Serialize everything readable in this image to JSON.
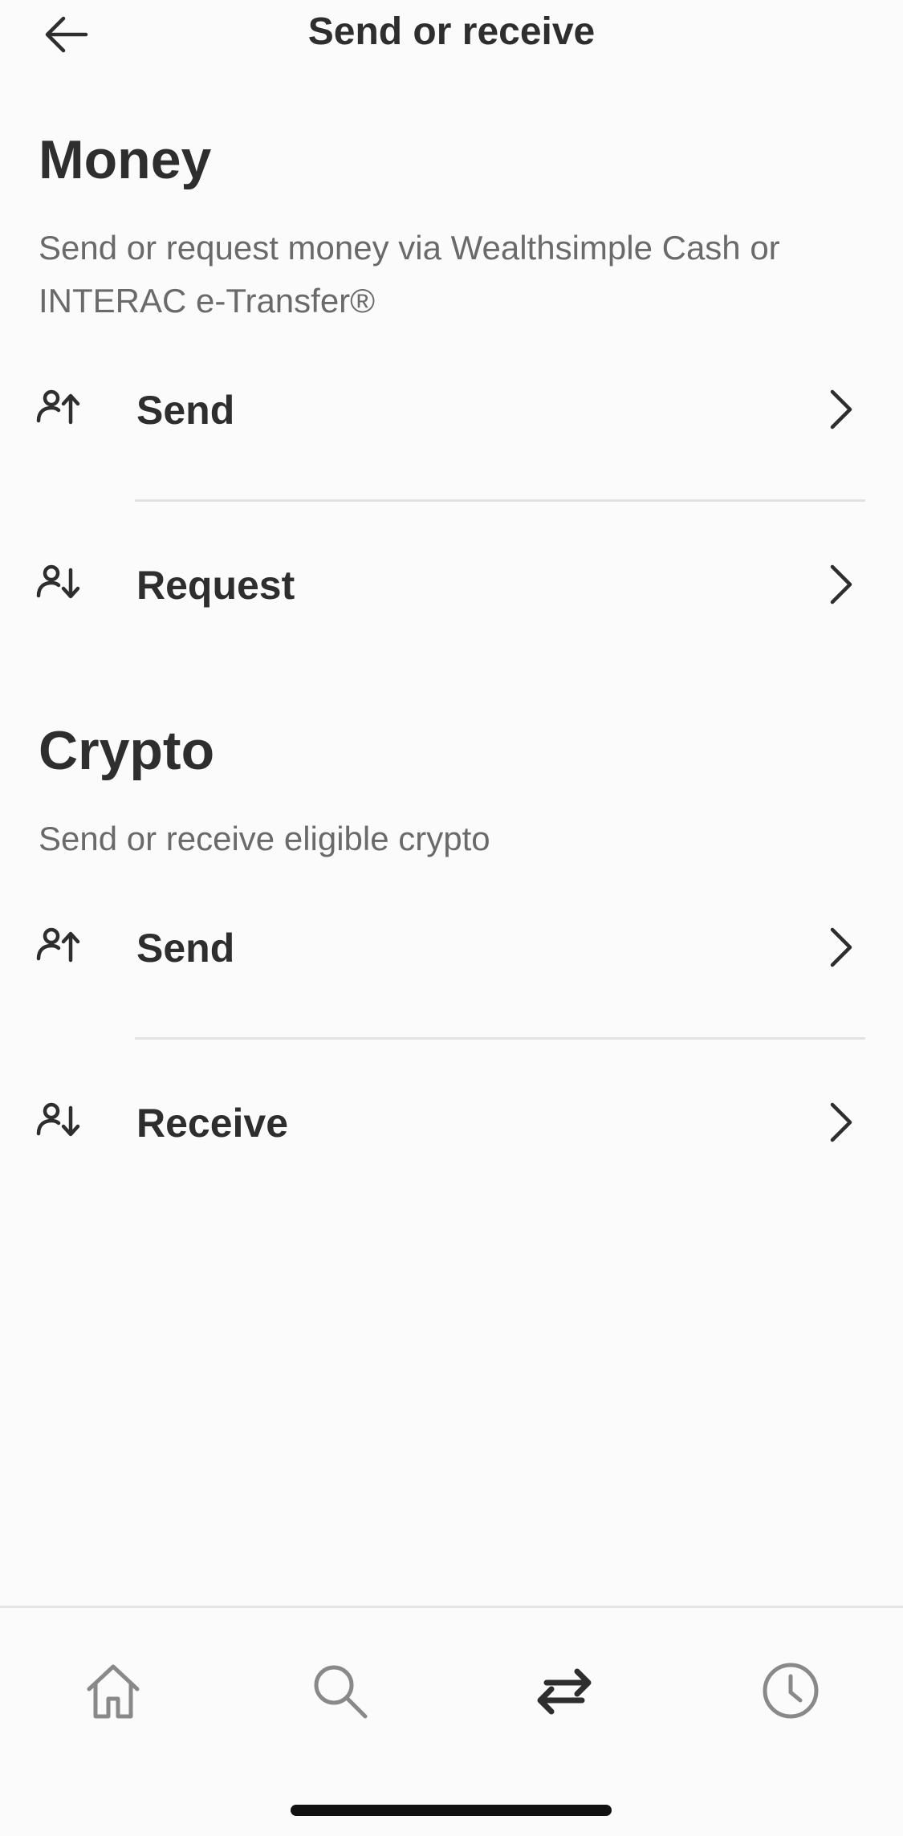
{
  "header": {
    "title": "Send or receive",
    "back_icon": "arrow-left-icon"
  },
  "sections": [
    {
      "title": "Money",
      "description": "Send or request money via Wealthsimple Cash or INTERAC e-Transfer®",
      "rows": [
        {
          "label": "Send",
          "icon": "person-arrow-up-icon"
        },
        {
          "label": "Request",
          "icon": "person-arrow-down-icon"
        }
      ]
    },
    {
      "title": "Crypto",
      "description": "Send or receive eligible crypto",
      "rows": [
        {
          "label": "Send",
          "icon": "person-arrow-up-icon"
        },
        {
          "label": "Receive",
          "icon": "person-arrow-down-icon"
        }
      ]
    }
  ],
  "tabbar": {
    "tabs": [
      {
        "icon": "home-icon",
        "active": false
      },
      {
        "icon": "search-icon",
        "active": false
      },
      {
        "icon": "transfer-arrows-icon",
        "active": true
      },
      {
        "icon": "clock-icon",
        "active": false
      }
    ]
  },
  "colors": {
    "text": "#2f2e2e",
    "secondary": "#6b6a6a",
    "inactive_icon": "#8a8989",
    "divider": "#e3e2e2",
    "background": "#fcfbfc"
  }
}
